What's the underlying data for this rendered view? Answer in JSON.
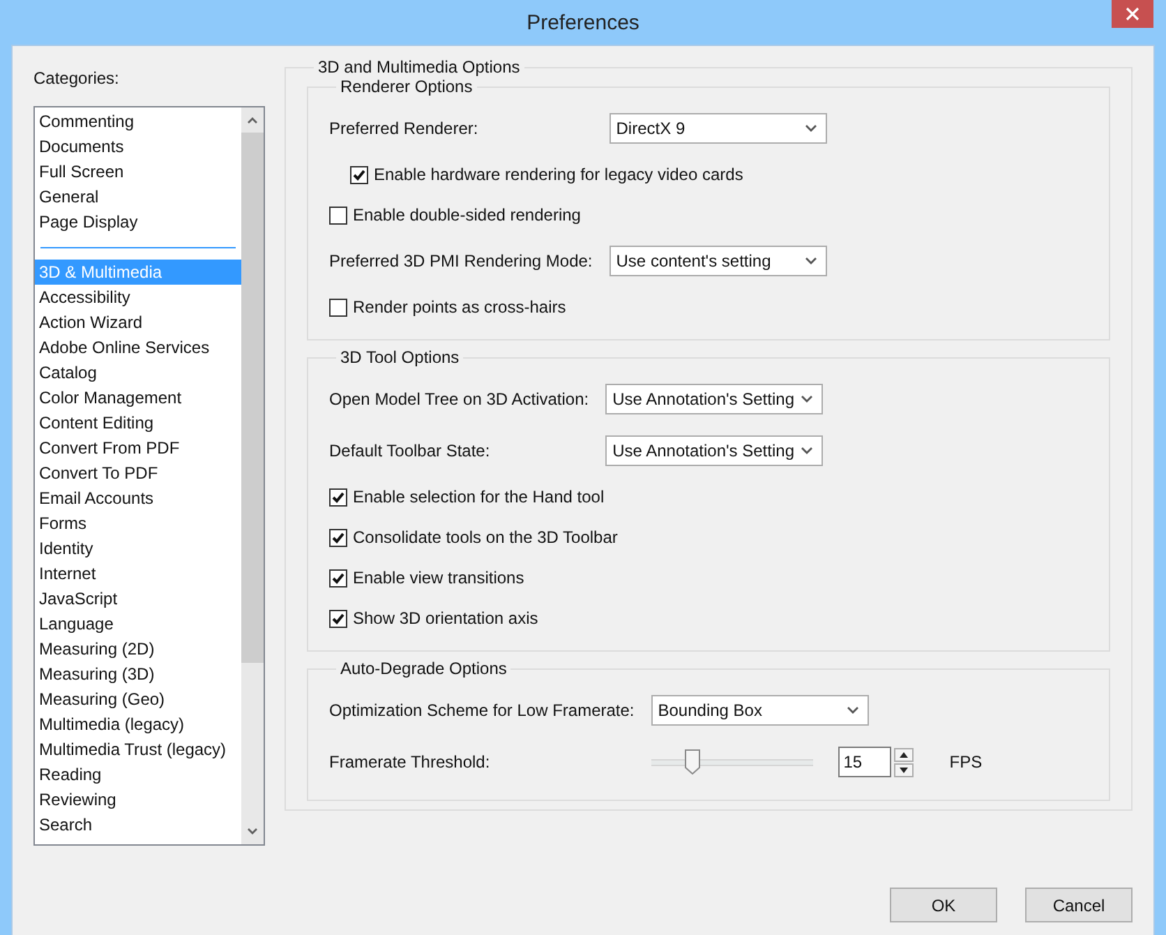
{
  "window": {
    "title": "Preferences"
  },
  "categories": {
    "label": "Categories:",
    "groups": [
      [
        {
          "label": "Commenting",
          "selected": false
        },
        {
          "label": "Documents",
          "selected": false
        },
        {
          "label": "Full Screen",
          "selected": false
        },
        {
          "label": "General",
          "selected": false
        },
        {
          "label": "Page Display",
          "selected": false
        }
      ],
      [
        {
          "label": "3D & Multimedia",
          "selected": true
        },
        {
          "label": "Accessibility",
          "selected": false
        },
        {
          "label": "Action Wizard",
          "selected": false
        },
        {
          "label": "Adobe Online Services",
          "selected": false
        },
        {
          "label": "Catalog",
          "selected": false
        },
        {
          "label": "Color Management",
          "selected": false
        },
        {
          "label": "Content Editing",
          "selected": false
        },
        {
          "label": "Convert From PDF",
          "selected": false
        },
        {
          "label": "Convert To PDF",
          "selected": false
        },
        {
          "label": "Email Accounts",
          "selected": false
        },
        {
          "label": "Forms",
          "selected": false
        },
        {
          "label": "Identity",
          "selected": false
        },
        {
          "label": "Internet",
          "selected": false
        },
        {
          "label": "JavaScript",
          "selected": false
        },
        {
          "label": "Language",
          "selected": false
        },
        {
          "label": "Measuring (2D)",
          "selected": false
        },
        {
          "label": "Measuring (3D)",
          "selected": false
        },
        {
          "label": "Measuring (Geo)",
          "selected": false
        },
        {
          "label": "Multimedia (legacy)",
          "selected": false
        },
        {
          "label": "Multimedia Trust (legacy)",
          "selected": false
        },
        {
          "label": "Reading",
          "selected": false
        },
        {
          "label": "Reviewing",
          "selected": false
        },
        {
          "label": "Search",
          "selected": false
        }
      ]
    ]
  },
  "panel": {
    "title": "3D and Multimedia Options",
    "groups": [
      {
        "title": "Renderer Options",
        "rows": [
          {
            "kind": "select",
            "label": "Preferred Renderer:",
            "value": "DirectX 9"
          },
          {
            "kind": "subcheckbox",
            "label": "Enable hardware rendering for legacy video cards",
            "checked": true
          },
          {
            "kind": "checkbox",
            "label": "Enable double-sided rendering",
            "checked": false
          },
          {
            "kind": "select",
            "label": "Preferred 3D PMI Rendering Mode:",
            "value": "Use content's setting"
          },
          {
            "kind": "checkbox",
            "label": "Render points as cross-hairs",
            "checked": false
          }
        ]
      },
      {
        "title": "3D Tool Options",
        "rows": [
          {
            "kind": "select",
            "label": "Open Model Tree on 3D Activation:",
            "value": "Use Annotation's Setting"
          },
          {
            "kind": "select",
            "label": "Default Toolbar State:",
            "value": "Use Annotation's Setting"
          },
          {
            "kind": "checkbox",
            "label": "Enable selection for the Hand tool",
            "checked": true
          },
          {
            "kind": "checkbox",
            "label": "Consolidate tools on the 3D Toolbar",
            "checked": true
          },
          {
            "kind": "checkbox",
            "label": "Enable view transitions",
            "checked": true
          },
          {
            "kind": "checkbox",
            "label": "Show 3D orientation axis",
            "checked": true
          }
        ]
      },
      {
        "title": "Auto-Degrade Options",
        "rows": [
          {
            "kind": "select",
            "label": "Optimization Scheme for Low Framerate:",
            "value": "Bounding Box"
          },
          {
            "kind": "slider",
            "label": "Framerate Threshold:",
            "level": 0.25,
            "value": "15",
            "unit": "FPS"
          }
        ]
      }
    ]
  },
  "buttons": [
    "OK",
    "Cancel"
  ]
}
